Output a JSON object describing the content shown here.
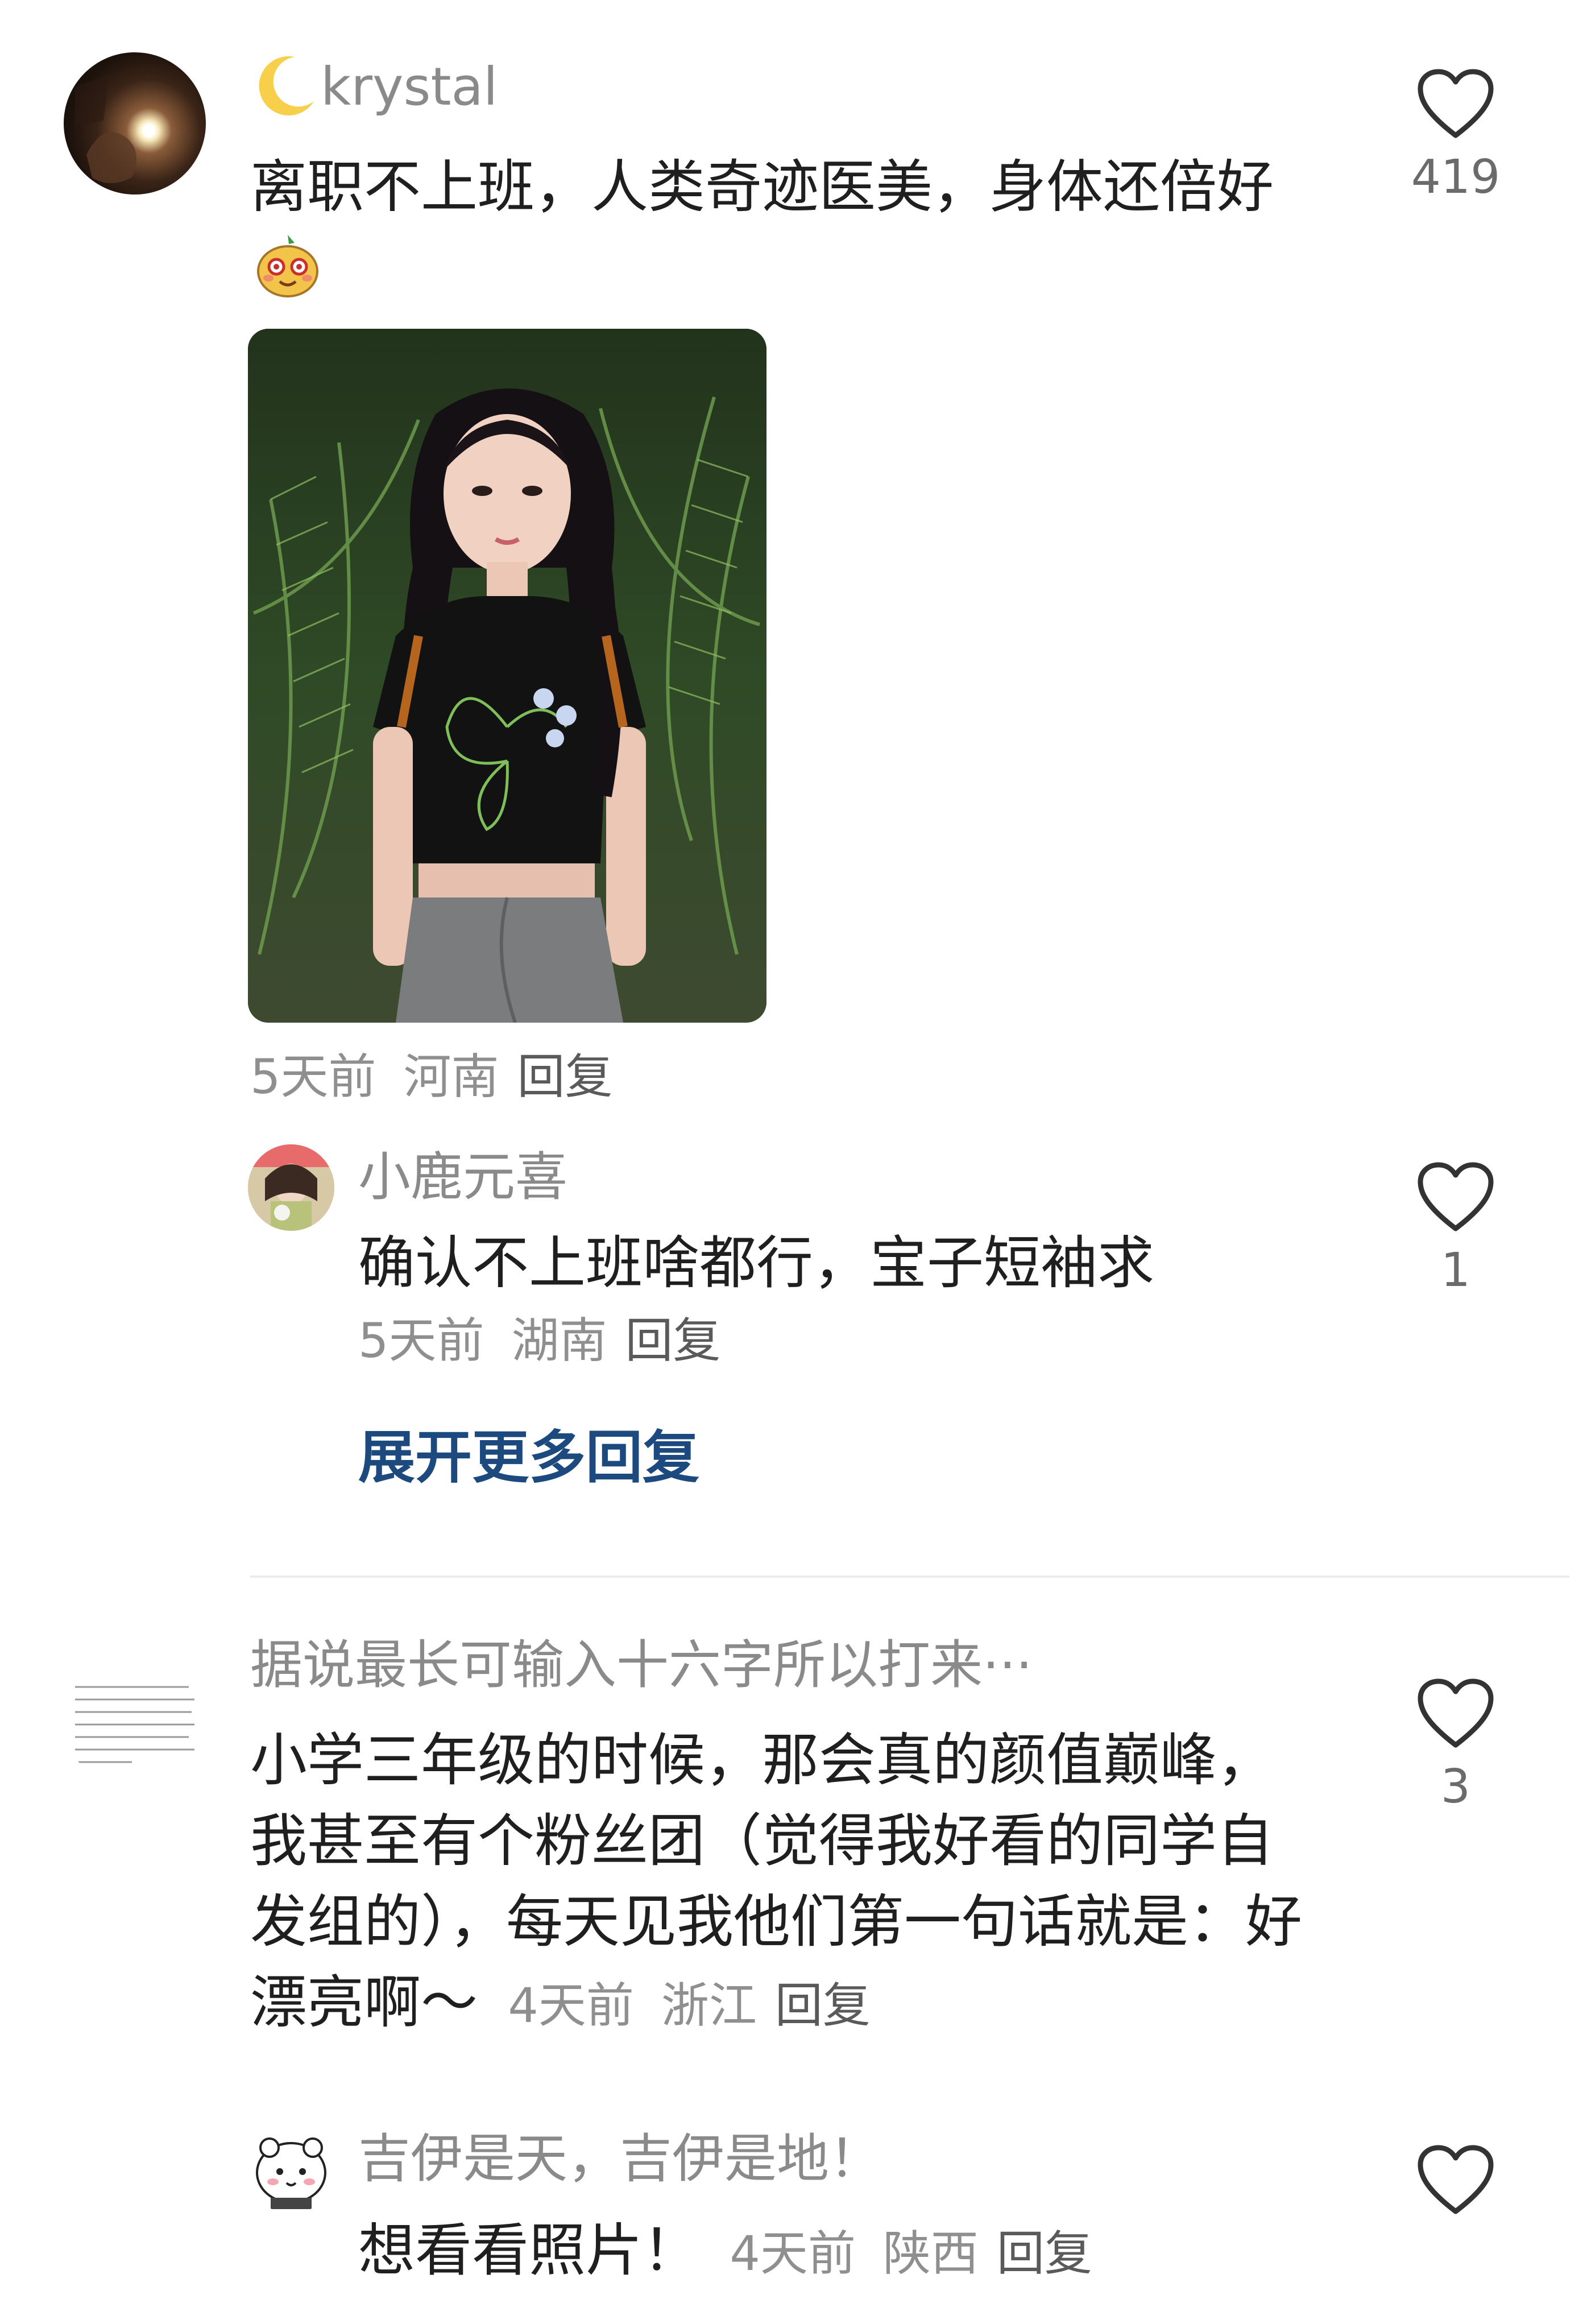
{
  "comments": [
    {
      "username": "krystal",
      "username_prefix_icon": "crescent-moon-emoji",
      "text": "离职不上班，人类奇迹医美，身体还倍好",
      "trailing_emoji": "sticker-emoji",
      "image_alt": "photo of girl in black t-shirt among plants",
      "time": "5天前",
      "location": "河南",
      "reply_label": "回复",
      "likes": "419",
      "replies": [
        {
          "username": "小鹿元喜",
          "text": "确认不上班啥都行，宝子短袖求",
          "time": "5天前",
          "location": "湖南",
          "reply_label": "回复",
          "likes": "1"
        }
      ],
      "expand_label": "展开更多回复"
    },
    {
      "username": "据说最长可输入十六字所以打来···",
      "text": "小学三年级的时候，那会真的颜值巅峰，我甚至有个粉丝团（觉得我好看的同学自发组的），每天见我他们第一句话就是：好漂亮啊～",
      "time": "4天前",
      "location": "浙江",
      "reply_label": "回复",
      "likes": "3",
      "replies": [
        {
          "username": "吉伊是天，吉伊是地！",
          "text": "想看看照片！",
          "time": "4天前",
          "location": "陕西",
          "reply_label": "回复",
          "likes": ""
        }
      ]
    }
  ],
  "colors": {
    "text": "#1f1f1f",
    "name": "#8a8a8a",
    "meta": "#8f8f8f",
    "link": "#1d4a7e",
    "divider": "#ececec"
  }
}
